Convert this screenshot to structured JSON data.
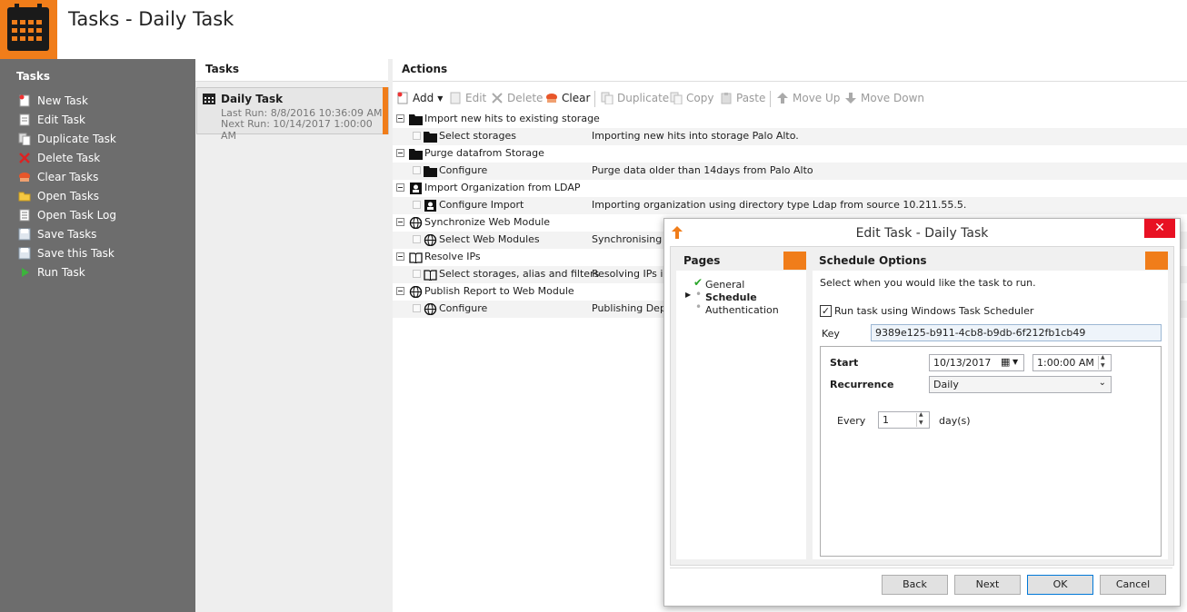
{
  "app": {
    "title": "Tasks - Daily Task"
  },
  "sidebar": {
    "title": "Tasks",
    "items": [
      {
        "label": "New Task",
        "icon": "new-task-icon"
      },
      {
        "label": "Edit Task",
        "icon": "edit-task-icon"
      },
      {
        "label": "Duplicate Task",
        "icon": "duplicate-task-icon"
      },
      {
        "label": "Delete Task",
        "icon": "delete-task-icon"
      },
      {
        "label": "Clear Tasks",
        "icon": "clear-tasks-icon"
      },
      {
        "label": "Open Tasks",
        "icon": "open-folder-icon"
      },
      {
        "label": "Open Task Log",
        "icon": "log-icon"
      },
      {
        "label": "Save Tasks",
        "icon": "save-icon"
      },
      {
        "label": "Save this Task",
        "icon": "save-icon"
      },
      {
        "label": "Run Task",
        "icon": "play-icon"
      }
    ]
  },
  "tasks": {
    "header": "Tasks",
    "selected": {
      "name": "Daily Task",
      "last_run": "Last Run: 8/8/2016 10:36:09 AM",
      "next_run": "Next Run: 10/14/2017 1:00:00 AM"
    }
  },
  "actions": {
    "header": "Actions",
    "toolbar": {
      "add": "Add",
      "edit": "Edit",
      "delete": "Delete",
      "clear": "Clear",
      "duplicate": "Duplicate",
      "copy": "Copy",
      "paste": "Paste",
      "move_up": "Move Up",
      "move_down": "Move Down"
    },
    "rows": [
      {
        "label": "Import new hits to existing storage",
        "desc": "",
        "child": false
      },
      {
        "label": "Select storages",
        "desc": "Importing new hits into storage Palo Alto.",
        "child": true
      },
      {
        "label": "Purge datafrom Storage",
        "desc": "",
        "child": false
      },
      {
        "label": "Configure",
        "desc": "Purge data older than 14days from Palo Alto",
        "child": true
      },
      {
        "label": "Import Organization from LDAP",
        "desc": "",
        "child": false
      },
      {
        "label": "Configure Import",
        "desc": "Importing organization using directory type Ldap from source 10.211.55.5.",
        "child": true
      },
      {
        "label": "Synchronize Web Module",
        "desc": "",
        "child": false
      },
      {
        "label": "Select Web Modules",
        "desc": "Synchronising W",
        "child": true
      },
      {
        "label": "Resolve IPs",
        "desc": "",
        "child": false
      },
      {
        "label": "Select storages, alias and filters",
        "desc": "Resolving IPs in",
        "child": true
      },
      {
        "label": "Publish Report to Web Module",
        "desc": "",
        "child": false
      },
      {
        "label": "Configure",
        "desc": "Publishing Depa",
        "child": true
      }
    ]
  },
  "dialog": {
    "title": "Edit Task - Daily Task",
    "close": "✕",
    "pages_header": "Pages",
    "pages": [
      "General",
      "Schedule",
      "Authentication"
    ],
    "options_header": "Schedule Options",
    "instruction": "Select when you would like the task to run.",
    "use_scheduler_label": "Run task using Windows Task Scheduler",
    "key_label": "Key",
    "key_value": "9389e125-b911-4cb8-b9db-6f212fb1cb49",
    "start_label": "Start",
    "start_date": "10/13/2017",
    "start_time": "1:00:00 AM",
    "recurrence_label": "Recurrence",
    "recurrence_value": "Daily",
    "every_label": "Every",
    "every_value": "1",
    "every_unit": "day(s)",
    "buttons": {
      "back": "Back",
      "next": "Next",
      "ok": "OK",
      "cancel": "Cancel"
    }
  },
  "colors": {
    "accent": "#f07d1a",
    "sidebar": "#6d6d6d",
    "close": "#e81123"
  }
}
